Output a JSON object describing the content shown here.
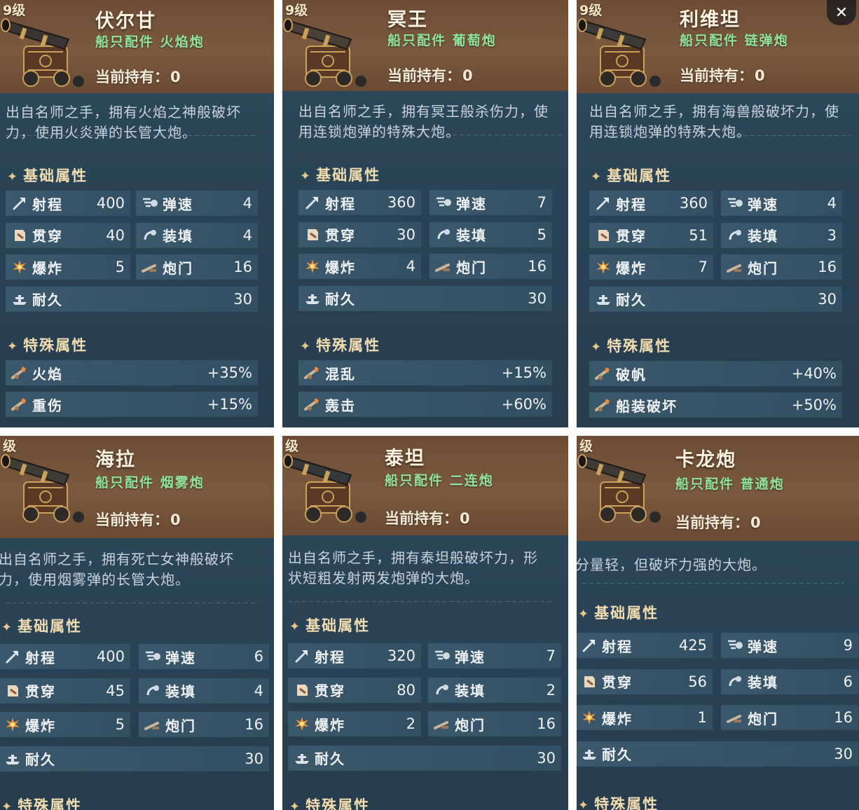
{
  "close_label": "✕",
  "section_basic": "基础属性",
  "section_special": "特殊属性",
  "owned_label": "当前持有：",
  "stat_labels": {
    "range": "射程",
    "speed": "弹速",
    "pierce": "贯穿",
    "reload": "装填",
    "explode": "爆炸",
    "gunport": "炮门",
    "durability": "耐久"
  },
  "cards": [
    {
      "level": "9级",
      "name": "伏尔甘",
      "type": "船只配件  火焰炮",
      "owned": "0",
      "desc": [
        "出自名师之手，拥有火焰之神般破坏",
        "力，使用火炎弹的长管大炮。"
      ],
      "stats": {
        "range": "400",
        "speed": "4",
        "pierce": "40",
        "reload": "4",
        "explode": "5",
        "gunport": "16",
        "durability": "30"
      },
      "special": [
        {
          "label": "火焰",
          "value": "+35%"
        },
        {
          "label": "重伤",
          "value": "+15%"
        }
      ]
    },
    {
      "level": "9级",
      "name": "冥王",
      "type": "船只配件  葡萄炮",
      "owned": "0",
      "desc": [
        "出自名师之手，拥有冥王般杀伤力，使",
        "用连锁炮弹的特殊大炮。"
      ],
      "stats": {
        "range": "360",
        "speed": "7",
        "pierce": "30",
        "reload": "5",
        "explode": "4",
        "gunport": "16",
        "durability": "30"
      },
      "special": [
        {
          "label": "混乱",
          "value": "+15%"
        },
        {
          "label": "轰击",
          "value": "+60%"
        }
      ]
    },
    {
      "level": "9级",
      "name": "利维坦",
      "type": "船只配件  链弹炮",
      "owned": "0",
      "desc": [
        "出自名师之手，拥有海兽般破坏力，使",
        "用连锁炮弹的特殊大炮。"
      ],
      "stats": {
        "range": "360",
        "speed": "4",
        "pierce": "51",
        "reload": "3",
        "explode": "7",
        "gunport": "16",
        "durability": "30"
      },
      "special": [
        {
          "label": "破帆",
          "value": "+40%"
        },
        {
          "label": "船装破坏",
          "value": "+50%"
        }
      ]
    },
    {
      "level": "级",
      "name": "海拉",
      "type": "船只配件  烟雾炮",
      "owned": "0",
      "desc": [
        "出自名师之手，拥有死亡女神般破坏",
        "力，使用烟雾弹的长管大炮。"
      ],
      "stats": {
        "range": "400",
        "speed": "6",
        "pierce": "45",
        "reload": "4",
        "explode": "5",
        "gunport": "16",
        "durability": "30"
      },
      "special": []
    },
    {
      "level": "级",
      "name": "泰坦",
      "type": "船只配件  二连炮",
      "owned": "0",
      "desc": [
        "出自名师之手，拥有泰坦般破坏力，形",
        "状短粗发射两发炮弹的大炮。"
      ],
      "stats": {
        "range": "320",
        "speed": "7",
        "pierce": "80",
        "reload": "2",
        "explode": "2",
        "gunport": "16",
        "durability": "30"
      },
      "special": []
    },
    {
      "level": "级",
      "name": "卡龙炮",
      "type": "船只配件  普通炮",
      "owned": "0",
      "desc": [
        "分量轻，但破坏力强的大炮。"
      ],
      "stats": {
        "range": "425",
        "speed": "9",
        "pierce": "56",
        "reload": "6",
        "explode": "1",
        "gunport": "16",
        "durability": "30"
      },
      "special": []
    }
  ]
}
